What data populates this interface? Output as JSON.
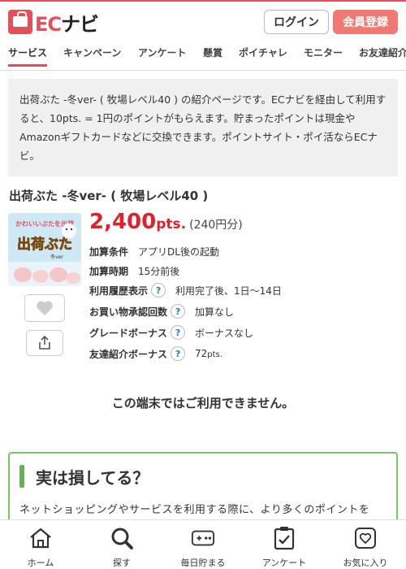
{
  "header": {
    "logo_text_ec": "EC",
    "logo_text_navi": "ナビ",
    "login_label": "ログイン",
    "register_label": "会員登録"
  },
  "nav": {
    "items": [
      {
        "label": "サービス",
        "active": true
      },
      {
        "label": "キャンペーン"
      },
      {
        "label": "アンケート"
      },
      {
        "label": "懸賞"
      },
      {
        "label": "ポイチャレ"
      },
      {
        "label": "モニター"
      },
      {
        "label": "お友達紹介"
      }
    ]
  },
  "description": "出荷ぶた -冬ver- ( 牧場レベル40 ) の紹介ページです。ECナビを経由して利用すると、10pts. = 1円のポイントがもらえます。貯まったポイントは現金やAmazonギフトカードなどに交換できます。ポイントサイト・ポイ活ならECナビ。",
  "title": "出荷ぶた -冬ver- ( 牧場レベル40 )",
  "thumbnail": {
    "top_text": "かわいいぶたを出荷",
    "main_text": "出荷ぶた",
    "sub_text": "冬ver"
  },
  "points": {
    "value": "2,400",
    "unit": "pts.",
    "yen": "(240円分)"
  },
  "info": {
    "condition_label": "加算条件",
    "condition_value": "アプリDL後の起動",
    "timing_label": "加算時期",
    "timing_value": "15分前後",
    "history_label": "利用履歴表示",
    "history_value": "利用完了後、1日～14日",
    "approval_label": "お買い物承認回数",
    "approval_value": "加算なし",
    "grade_label": "グレードボーナス",
    "grade_value": "ボーナスなし",
    "friend_label": "友達紹介ボーナス",
    "friend_value": "72",
    "friend_unit": "pts.",
    "help_glyph": "?"
  },
  "unavailable_text": "この端末ではご利用できません。",
  "hint": {
    "title": "実は損してる？",
    "body": "ネットショッピングやサービスを利用する際に、より多くのポイントを"
  },
  "bottom_nav": [
    {
      "label": "ホーム",
      "icon": "home-icon"
    },
    {
      "label": "探す",
      "icon": "search-icon"
    },
    {
      "label": "毎日貯まる",
      "icon": "gamepad-icon"
    },
    {
      "label": "アンケート",
      "icon": "clipboard-check-icon"
    },
    {
      "label": "お気に入り",
      "icon": "heart-icon"
    }
  ],
  "colors": {
    "brand_red": "#e3505a",
    "point_red": "#e3202a",
    "register_bg": "#f07a73",
    "hint_green": "#7fc06a",
    "help_blue": "#1a7bd0"
  }
}
